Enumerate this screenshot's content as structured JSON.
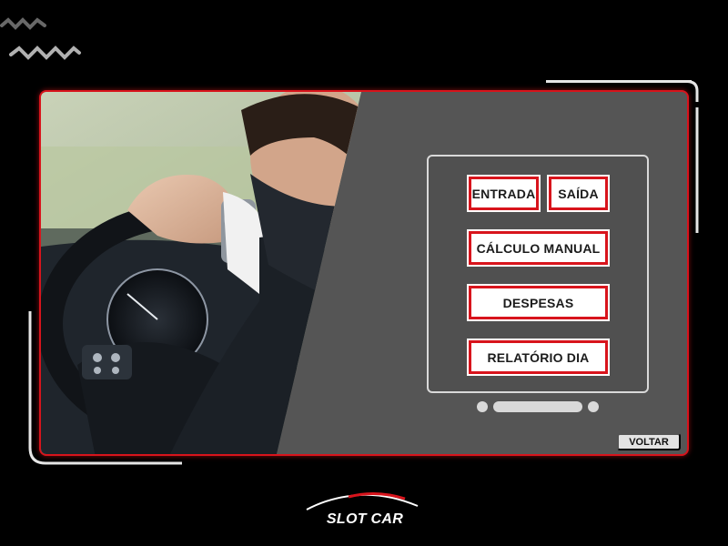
{
  "menu": {
    "entrada": "ENTRADA",
    "saida": "SAÍDA",
    "calculo_manual": "CÁLCULO MANUAL",
    "despesas": "DESPESAS",
    "relatorio_dia": "RELATÓRIO DIA"
  },
  "back_button": "VOLTAR",
  "brand": {
    "name": "SLOT CAR"
  },
  "pager": {
    "pages": 3,
    "active_index": 1
  },
  "colors": {
    "accent": "#d8141c",
    "panel": "#555555",
    "background": "#000000"
  },
  "icons": [
    "squiggle-decoration-icon",
    "car-silhouette-logo-icon"
  ]
}
